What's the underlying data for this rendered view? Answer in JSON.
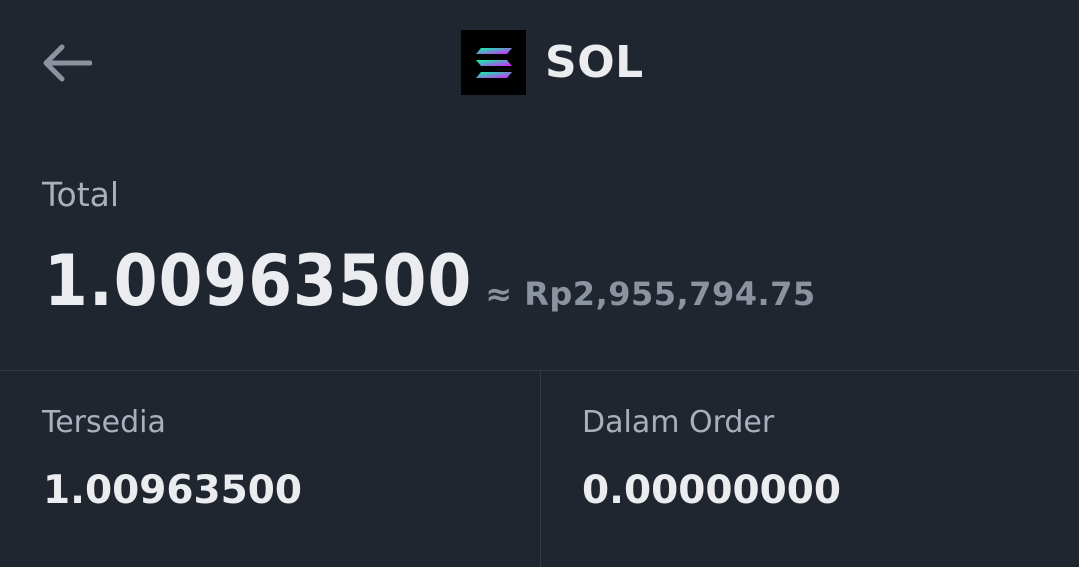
{
  "header": {
    "back_icon": "arrow-left-icon",
    "coin_icon": "solana-logo-icon",
    "coin_symbol": "SOL"
  },
  "total": {
    "label": "Total",
    "amount": "1.00963500",
    "fiat_value": "≈ Rp2,955,794.75"
  },
  "available": {
    "label": "Tersedia",
    "amount": "1.00963500"
  },
  "in_order": {
    "label": "Dalam Order",
    "amount": "0.00000000"
  },
  "colors": {
    "background": "#1f2630",
    "primary_text": "#eaecef",
    "secondary_text": "#a9b0bc",
    "divider": "#323a46",
    "logo_gradient": [
      "#00ffa3",
      "#dc1fff"
    ]
  }
}
